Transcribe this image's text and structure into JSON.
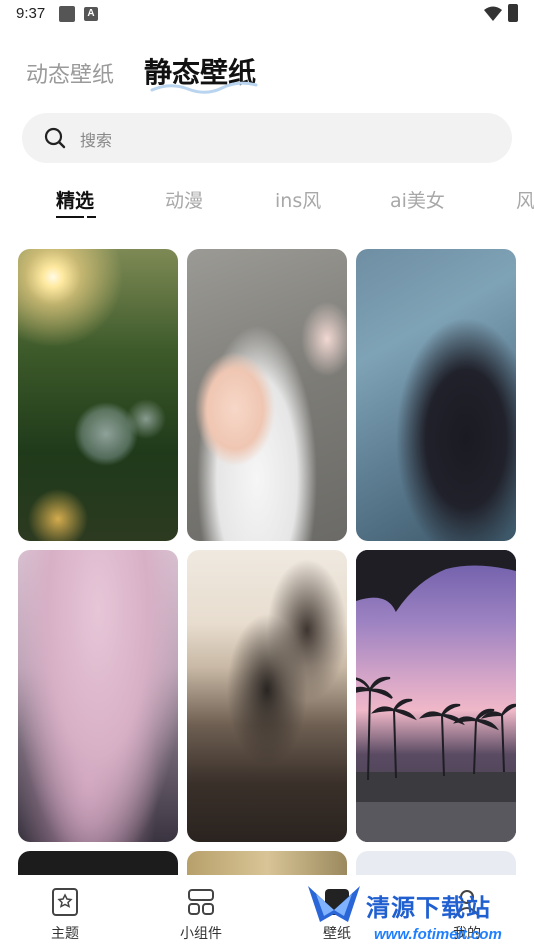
{
  "status_bar": {
    "time": "9:37",
    "a_icon": "A"
  },
  "header": {
    "tabs": [
      {
        "label": "动态壁纸",
        "active": false
      },
      {
        "label": "静态壁纸",
        "active": true
      }
    ]
  },
  "search": {
    "placeholder": "搜索"
  },
  "categories": [
    {
      "label": "精选",
      "active": true
    },
    {
      "label": "动漫",
      "active": false
    },
    {
      "label": "ins风",
      "active": false
    },
    {
      "label": "ai美女",
      "active": false
    },
    {
      "label": "风",
      "active": false
    }
  ],
  "wallpapers": [
    {
      "name": "bokeh-bubbles"
    },
    {
      "name": "two-girls-selfie"
    },
    {
      "name": "aquarium-girl"
    },
    {
      "name": "cherry-blossom"
    },
    {
      "name": "beach-silhouettes"
    },
    {
      "name": "palm-trees-sunset"
    },
    {
      "name": "partial-1"
    },
    {
      "name": "partial-2"
    },
    {
      "name": "partial-3"
    }
  ],
  "bottom_nav": [
    {
      "label": "主题",
      "icon": "theme-icon"
    },
    {
      "label": "小组件",
      "icon": "widget-icon"
    },
    {
      "label": "壁纸",
      "icon": "wallpaper-icon"
    },
    {
      "label": "我的",
      "icon": "profile-icon"
    }
  ],
  "watermark": {
    "text": "清源下载站",
    "url": "www.fotimeit.com"
  },
  "colors": {
    "accent": "#111111",
    "muted": "#a8a8a8",
    "search_bg": "#f2f2f2"
  }
}
